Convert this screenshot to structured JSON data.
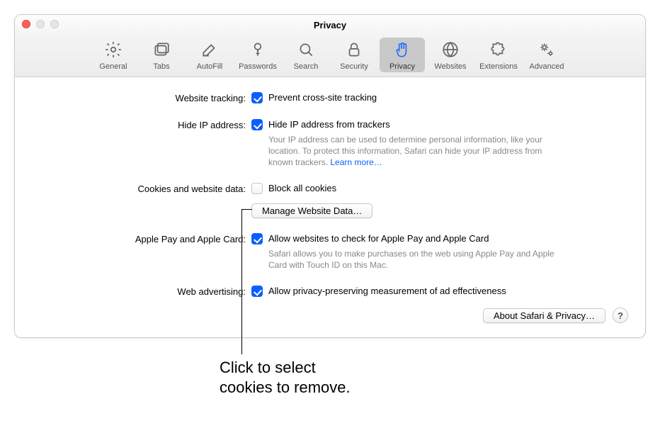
{
  "window": {
    "title": "Privacy"
  },
  "toolbar": [
    {
      "id": "general",
      "label": "General"
    },
    {
      "id": "tabs",
      "label": "Tabs"
    },
    {
      "id": "autofill",
      "label": "AutoFill"
    },
    {
      "id": "passwords",
      "label": "Passwords"
    },
    {
      "id": "search",
      "label": "Search"
    },
    {
      "id": "security",
      "label": "Security"
    },
    {
      "id": "privacy",
      "label": "Privacy",
      "selected": true
    },
    {
      "id": "websites",
      "label": "Websites"
    },
    {
      "id": "extensions",
      "label": "Extensions"
    },
    {
      "id": "advanced",
      "label": "Advanced"
    }
  ],
  "sections": {
    "tracking": {
      "label": "Website tracking:",
      "checkbox_label": "Prevent cross-site tracking",
      "checked": true
    },
    "hideip": {
      "label": "Hide IP address:",
      "checkbox_label": "Hide IP address from trackers",
      "checked": true,
      "desc": "Your IP address can be used to determine personal information, like your location. To protect this information, Safari can hide your IP address from known trackers. ",
      "learn_more": "Learn more…"
    },
    "cookies": {
      "label": "Cookies and website data:",
      "checkbox_label": "Block all cookies",
      "checked": false,
      "manage_button": "Manage Website Data…"
    },
    "applepay": {
      "label": "Apple Pay and Apple Card:",
      "checkbox_label": "Allow websites to check for Apple Pay and Apple Card",
      "checked": true,
      "desc": "Safari allows you to make purchases on the web using Apple Pay and Apple Card with Touch ID on this Mac."
    },
    "webads": {
      "label": "Web advertising:",
      "checkbox_label": "Allow privacy-preserving measurement of ad effectiveness",
      "checked": true
    }
  },
  "footer": {
    "about_button": "About Safari & Privacy…",
    "help": "?"
  },
  "annotation": {
    "line1": "Click to select",
    "line2": "cookies to remove."
  }
}
